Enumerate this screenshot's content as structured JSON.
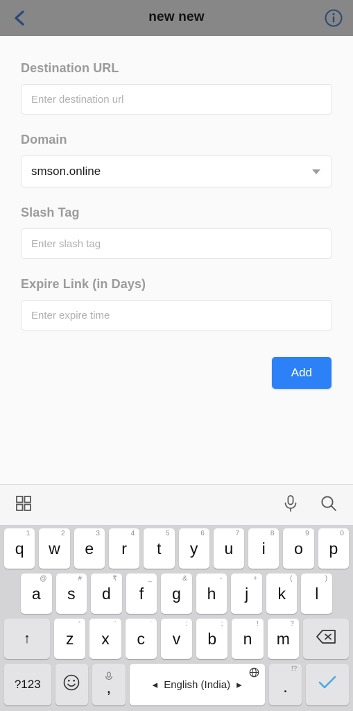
{
  "header": {
    "title": "new new",
    "back_icon": "back-chevron-icon",
    "info_icon": "info-circle-icon",
    "bg_color": "#878787",
    "accent_color": "#2b4a75"
  },
  "form": {
    "fields": [
      {
        "label": "Destination URL",
        "placeholder": "Enter destination url",
        "value": "",
        "type": "text"
      },
      {
        "label": "Domain",
        "placeholder": "",
        "value": "smson.online",
        "type": "select"
      },
      {
        "label": "Slash Tag",
        "placeholder": "Enter slash tag",
        "value": "",
        "type": "text"
      },
      {
        "label": "Expire Link (in Days)",
        "placeholder": "Enter expire time",
        "value": "",
        "type": "text"
      }
    ],
    "submit_label": "Add",
    "submit_color": "#2d81f7"
  },
  "keyboard": {
    "toolbar": {
      "grid_icon": "grid-apps-icon",
      "mic_icon": "microphone-icon",
      "search_icon": "search-icon"
    },
    "row1": [
      {
        "key": "q",
        "sup": "1"
      },
      {
        "key": "w",
        "sup": "2"
      },
      {
        "key": "e",
        "sup": "3"
      },
      {
        "key": "r",
        "sup": "4"
      },
      {
        "key": "t",
        "sup": "5"
      },
      {
        "key": "y",
        "sup": "6"
      },
      {
        "key": "u",
        "sup": "7"
      },
      {
        "key": "i",
        "sup": "8"
      },
      {
        "key": "o",
        "sup": "9"
      },
      {
        "key": "p",
        "sup": "0"
      }
    ],
    "row2": [
      {
        "key": "a",
        "sup": "@"
      },
      {
        "key": "s",
        "sup": "#"
      },
      {
        "key": "d",
        "sup": "₹"
      },
      {
        "key": "f",
        "sup": "_"
      },
      {
        "key": "g",
        "sup": "&"
      },
      {
        "key": "h",
        "sup": "-"
      },
      {
        "key": "j",
        "sup": "+"
      },
      {
        "key": "k",
        "sup": "("
      },
      {
        "key": "l",
        "sup": ")"
      }
    ],
    "row3": {
      "shift_label": "↑",
      "keys": [
        {
          "key": "z",
          "sup": "*"
        },
        {
          "key": "x",
          "sup": "\""
        },
        {
          "key": "c",
          "sup": "'"
        },
        {
          "key": "v",
          "sup": ":"
        },
        {
          "key": "b",
          "sup": ";"
        },
        {
          "key": "n",
          "sup": "!"
        },
        {
          "key": "m",
          "sup": "?"
        }
      ],
      "backspace_icon": "backspace-icon"
    },
    "row4": {
      "symbols_label": "?123",
      "emoji_icon": "emoji-smiley-icon",
      "comma_label": ",",
      "comma_sup_icon": "microphone-icon",
      "space_label": "English (India)",
      "space_left_arrow": "◂",
      "space_right_arrow": "▸",
      "globe_icon": "globe-icon",
      "period_label": ".",
      "period_sup": "!?",
      "enter_icon": "checkmark-icon",
      "enter_color": "#4aa8e0"
    }
  }
}
